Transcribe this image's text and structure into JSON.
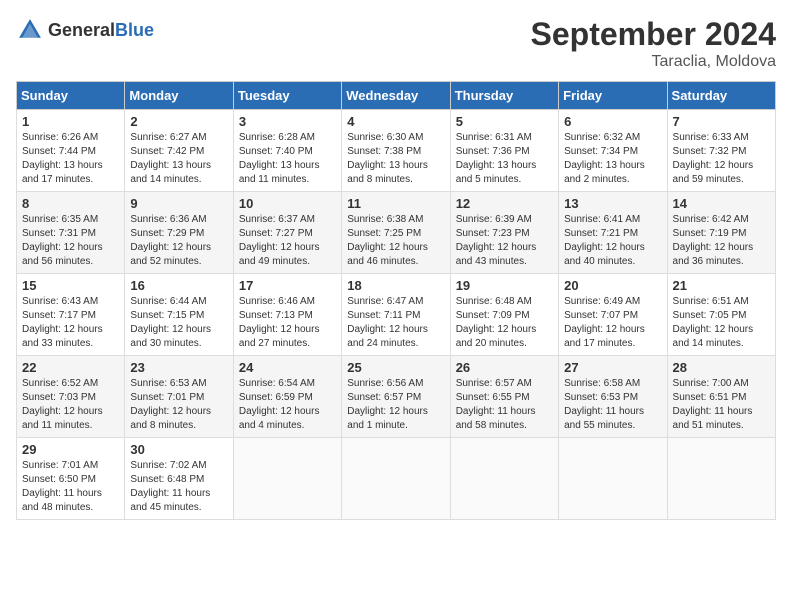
{
  "header": {
    "logo_general": "General",
    "logo_blue": "Blue",
    "month_title": "September 2024",
    "location": "Taraclia, Moldova"
  },
  "columns": [
    "Sunday",
    "Monday",
    "Tuesday",
    "Wednesday",
    "Thursday",
    "Friday",
    "Saturday"
  ],
  "weeks": [
    [
      {
        "day": "1",
        "sunrise": "Sunrise: 6:26 AM",
        "sunset": "Sunset: 7:44 PM",
        "daylight": "Daylight: 13 hours and 17 minutes."
      },
      {
        "day": "2",
        "sunrise": "Sunrise: 6:27 AM",
        "sunset": "Sunset: 7:42 PM",
        "daylight": "Daylight: 13 hours and 14 minutes."
      },
      {
        "day": "3",
        "sunrise": "Sunrise: 6:28 AM",
        "sunset": "Sunset: 7:40 PM",
        "daylight": "Daylight: 13 hours and 11 minutes."
      },
      {
        "day": "4",
        "sunrise": "Sunrise: 6:30 AM",
        "sunset": "Sunset: 7:38 PM",
        "daylight": "Daylight: 13 hours and 8 minutes."
      },
      {
        "day": "5",
        "sunrise": "Sunrise: 6:31 AM",
        "sunset": "Sunset: 7:36 PM",
        "daylight": "Daylight: 13 hours and 5 minutes."
      },
      {
        "day": "6",
        "sunrise": "Sunrise: 6:32 AM",
        "sunset": "Sunset: 7:34 PM",
        "daylight": "Daylight: 13 hours and 2 minutes."
      },
      {
        "day": "7",
        "sunrise": "Sunrise: 6:33 AM",
        "sunset": "Sunset: 7:32 PM",
        "daylight": "Daylight: 12 hours and 59 minutes."
      }
    ],
    [
      {
        "day": "8",
        "sunrise": "Sunrise: 6:35 AM",
        "sunset": "Sunset: 7:31 PM",
        "daylight": "Daylight: 12 hours and 56 minutes."
      },
      {
        "day": "9",
        "sunrise": "Sunrise: 6:36 AM",
        "sunset": "Sunset: 7:29 PM",
        "daylight": "Daylight: 12 hours and 52 minutes."
      },
      {
        "day": "10",
        "sunrise": "Sunrise: 6:37 AM",
        "sunset": "Sunset: 7:27 PM",
        "daylight": "Daylight: 12 hours and 49 minutes."
      },
      {
        "day": "11",
        "sunrise": "Sunrise: 6:38 AM",
        "sunset": "Sunset: 7:25 PM",
        "daylight": "Daylight: 12 hours and 46 minutes."
      },
      {
        "day": "12",
        "sunrise": "Sunrise: 6:39 AM",
        "sunset": "Sunset: 7:23 PM",
        "daylight": "Daylight: 12 hours and 43 minutes."
      },
      {
        "day": "13",
        "sunrise": "Sunrise: 6:41 AM",
        "sunset": "Sunset: 7:21 PM",
        "daylight": "Daylight: 12 hours and 40 minutes."
      },
      {
        "day": "14",
        "sunrise": "Sunrise: 6:42 AM",
        "sunset": "Sunset: 7:19 PM",
        "daylight": "Daylight: 12 hours and 36 minutes."
      }
    ],
    [
      {
        "day": "15",
        "sunrise": "Sunrise: 6:43 AM",
        "sunset": "Sunset: 7:17 PM",
        "daylight": "Daylight: 12 hours and 33 minutes."
      },
      {
        "day": "16",
        "sunrise": "Sunrise: 6:44 AM",
        "sunset": "Sunset: 7:15 PM",
        "daylight": "Daylight: 12 hours and 30 minutes."
      },
      {
        "day": "17",
        "sunrise": "Sunrise: 6:46 AM",
        "sunset": "Sunset: 7:13 PM",
        "daylight": "Daylight: 12 hours and 27 minutes."
      },
      {
        "day": "18",
        "sunrise": "Sunrise: 6:47 AM",
        "sunset": "Sunset: 7:11 PM",
        "daylight": "Daylight: 12 hours and 24 minutes."
      },
      {
        "day": "19",
        "sunrise": "Sunrise: 6:48 AM",
        "sunset": "Sunset: 7:09 PM",
        "daylight": "Daylight: 12 hours and 20 minutes."
      },
      {
        "day": "20",
        "sunrise": "Sunrise: 6:49 AM",
        "sunset": "Sunset: 7:07 PM",
        "daylight": "Daylight: 12 hours and 17 minutes."
      },
      {
        "day": "21",
        "sunrise": "Sunrise: 6:51 AM",
        "sunset": "Sunset: 7:05 PM",
        "daylight": "Daylight: 12 hours and 14 minutes."
      }
    ],
    [
      {
        "day": "22",
        "sunrise": "Sunrise: 6:52 AM",
        "sunset": "Sunset: 7:03 PM",
        "daylight": "Daylight: 12 hours and 11 minutes."
      },
      {
        "day": "23",
        "sunrise": "Sunrise: 6:53 AM",
        "sunset": "Sunset: 7:01 PM",
        "daylight": "Daylight: 12 hours and 8 minutes."
      },
      {
        "day": "24",
        "sunrise": "Sunrise: 6:54 AM",
        "sunset": "Sunset: 6:59 PM",
        "daylight": "Daylight: 12 hours and 4 minutes."
      },
      {
        "day": "25",
        "sunrise": "Sunrise: 6:56 AM",
        "sunset": "Sunset: 6:57 PM",
        "daylight": "Daylight: 12 hours and 1 minute."
      },
      {
        "day": "26",
        "sunrise": "Sunrise: 6:57 AM",
        "sunset": "Sunset: 6:55 PM",
        "daylight": "Daylight: 11 hours and 58 minutes."
      },
      {
        "day": "27",
        "sunrise": "Sunrise: 6:58 AM",
        "sunset": "Sunset: 6:53 PM",
        "daylight": "Daylight: 11 hours and 55 minutes."
      },
      {
        "day": "28",
        "sunrise": "Sunrise: 7:00 AM",
        "sunset": "Sunset: 6:51 PM",
        "daylight": "Daylight: 11 hours and 51 minutes."
      }
    ],
    [
      {
        "day": "29",
        "sunrise": "Sunrise: 7:01 AM",
        "sunset": "Sunset: 6:50 PM",
        "daylight": "Daylight: 11 hours and 48 minutes."
      },
      {
        "day": "30",
        "sunrise": "Sunrise: 7:02 AM",
        "sunset": "Sunset: 6:48 PM",
        "daylight": "Daylight: 11 hours and 45 minutes."
      },
      null,
      null,
      null,
      null,
      null
    ]
  ]
}
